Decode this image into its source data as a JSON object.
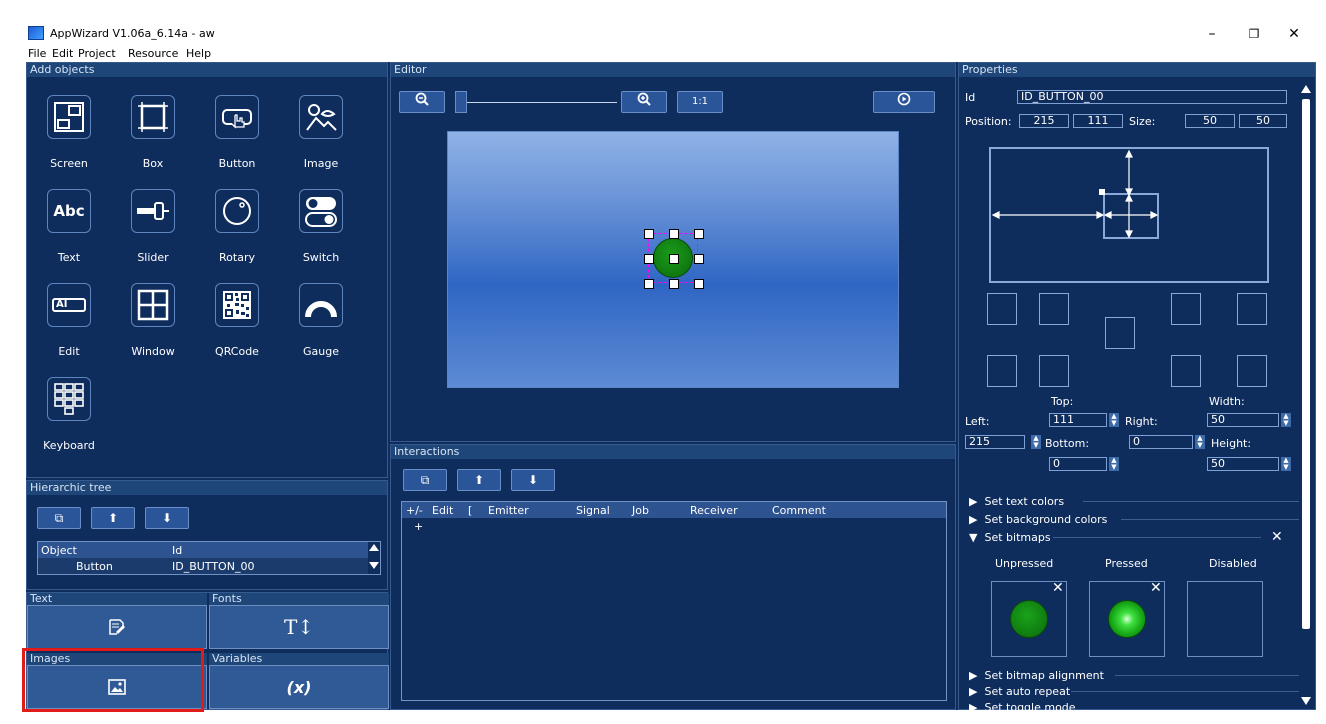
{
  "window": {
    "title": "AppWizard V1.06a_6.14a - aw",
    "controls": [
      "–",
      "❐",
      "✕"
    ]
  },
  "menu": [
    "File",
    "Edit",
    "Project",
    "Resource",
    "Help"
  ],
  "add_objects": {
    "header": "Add objects",
    "items": [
      "Screen",
      "Box",
      "Button",
      "Image",
      "Text",
      "Slider",
      "Rotary",
      "Switch",
      "Edit",
      "Window",
      "QRCode",
      "Gauge",
      "Keyboard"
    ],
    "abc_glyph": "Abc",
    "ai_glyph": "AI"
  },
  "hier_tree": {
    "header": "Hierarchic tree",
    "columns": [
      "Object",
      "Id"
    ],
    "rows": [
      {
        "object": "Button",
        "id": "ID_BUTTON_00"
      }
    ]
  },
  "resources": {
    "text": "Text",
    "fonts": "Fonts",
    "images": "Images",
    "variables": "Variables",
    "fonts_glyph": "T↕",
    "variables_glyph": "(x)"
  },
  "editor": {
    "header": "Editor",
    "zoom_ratio": "1:1"
  },
  "interactions": {
    "header": "Interactions",
    "columns": [
      "+/-",
      "Edit",
      "[",
      "Emitter",
      "Signal",
      "Job",
      "Receiver",
      "Comment"
    ],
    "add_row": "+"
  },
  "properties": {
    "header": "Properties",
    "id_label": "Id",
    "id_value": "ID_BUTTON_00",
    "position_label": "Position:",
    "pos_x": "215",
    "pos_y": "111",
    "size_label": "Size:",
    "size_w": "50",
    "size_h": "50",
    "top_label": "Top:",
    "width_label": "Width:",
    "left_label": "Left:",
    "right_label": "Right:",
    "bottom_label": "Bottom:",
    "height_label": "Height:",
    "top_value": "111",
    "right_value": "50",
    "left_value": "215",
    "bottom_value": "0",
    "width_value": "50",
    "height_value": "50",
    "extra_value": "0",
    "sections": [
      "Set text colors",
      "Set background colors",
      "Set bitmaps",
      "Set bitmap alignment",
      "Set auto repeat",
      "Set toggle mode"
    ],
    "bitmap_labels": [
      "Unpressed",
      "Pressed",
      "Disabled"
    ]
  }
}
